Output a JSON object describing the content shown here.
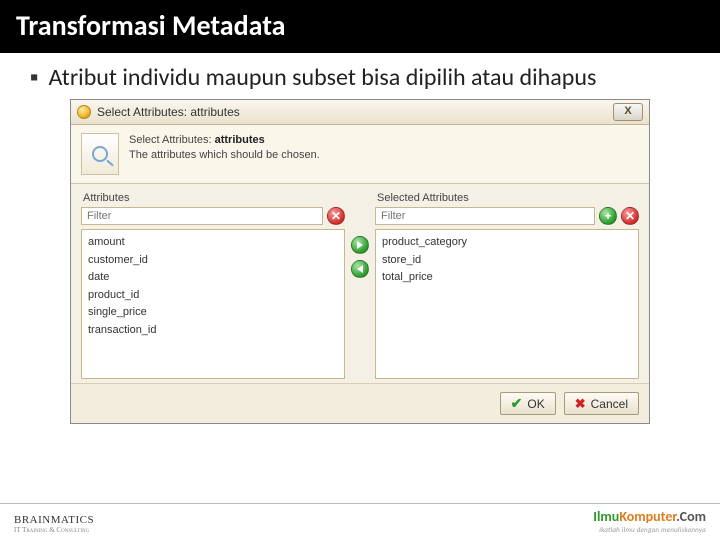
{
  "slide": {
    "title": "Transformasi Metadata",
    "bullet": "Atribut individu maupun subset bisa dipilih atau dihapus"
  },
  "dialog": {
    "window_title": "Select Attributes: attributes",
    "close_glyph": "X",
    "desc_heading": "Select Attributes: attributes",
    "desc_text": "The attributes which should be chosen.",
    "left": {
      "label": "Attributes",
      "filter_placeholder": "Filter",
      "items": [
        "amount",
        "customer_id",
        "date",
        "product_id",
        "single_price",
        "transaction_id"
      ]
    },
    "right": {
      "label": "Selected Attributes",
      "filter_placeholder": "Filter",
      "items": [
        "product_category",
        "store_id",
        "total_price"
      ]
    },
    "buttons": {
      "ok": "OK",
      "cancel": "Cancel"
    }
  },
  "footer": {
    "left_brand": "BRAINMATICS",
    "left_tag": "IT Training & Consulting",
    "right_brand_a": "Ilmu",
    "right_brand_b": "Komputer",
    "right_brand_suffix": ".Com",
    "right_tag": "Ikatlah ilmu dengan menuliskannya"
  }
}
